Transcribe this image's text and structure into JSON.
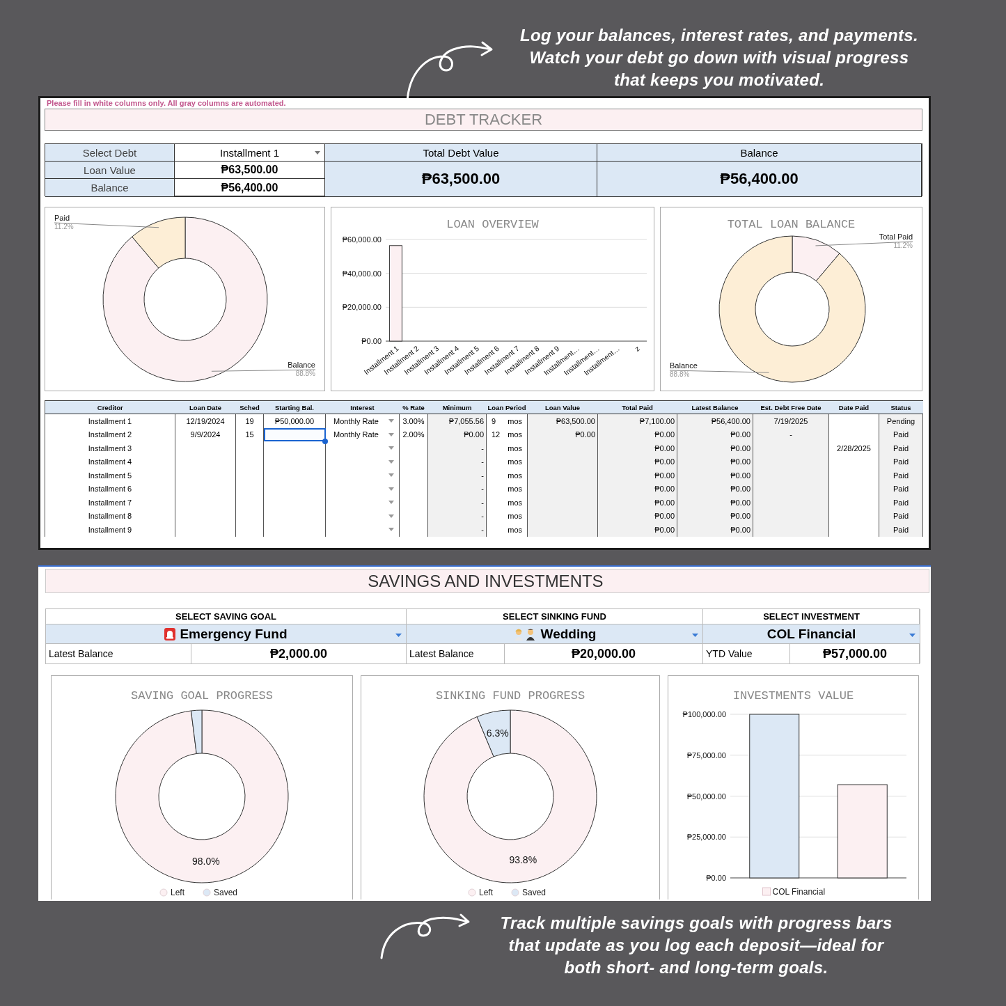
{
  "top_note": {
    "text": "Log your balances, interest rates, and payments.\nWatch your debt go down with visual progress\nthat keeps you motivated."
  },
  "debt_tracker": {
    "notice": "Please fill in white columns only. All gray columns are automated.",
    "title": "DEBT TRACKER",
    "selector": {
      "label": "Select Debt",
      "value": "Installment 1",
      "rows": [
        {
          "label": "Loan Value",
          "value": "₱63,500.00"
        },
        {
          "label": "Balance",
          "value": "₱56,400.00"
        }
      ]
    },
    "totals": [
      {
        "label": "Total Debt Value",
        "value": "₱63,500.00"
      },
      {
        "label": "Balance",
        "value": "₱56,400.00"
      }
    ],
    "charts": [
      {
        "chart_data": {
          "type": "donut",
          "categories": [
            "Balance",
            "Paid"
          ],
          "values": [
            88.8,
            11.2
          ],
          "colors": [
            "#fcf0f2",
            "#fdeed6"
          ],
          "value_labels": [
            "88.8%",
            "11.2%"
          ]
        }
      },
      {
        "chart_data": {
          "type": "bar",
          "title": "LOAN OVERVIEW",
          "grid": true,
          "categories": [
            "Installment 1",
            "Installment 2",
            "Installment 3",
            "Installment 4",
            "Installment 5",
            "Installment 6",
            "Installment 7",
            "Installment 8",
            "Installment 9",
            "Installment…",
            "Installment…",
            "Installment…",
            "z"
          ],
          "values": [
            56400,
            0,
            0,
            0,
            0,
            0,
            0,
            0,
            0,
            0,
            0,
            0,
            0
          ],
          "colors": [
            "#fcf0f2",
            "#fcf0f2",
            "#fcf0f2",
            "#fcf0f2",
            "#fcf0f2",
            "#fcf0f2",
            "#fcf0f2",
            "#fcf0f2",
            "#fcf0f2",
            "#fcf0f2",
            "#fcf0f2",
            "#fcf0f2",
            "#fcf0f2"
          ],
          "ylim": [
            0,
            60000
          ],
          "yticks": [
            {
              "value": 0,
              "label": "₱0.00"
            },
            {
              "value": 20000,
              "label": "₱20,000.00"
            },
            {
              "value": 40000,
              "label": "₱40,000.00"
            },
            {
              "value": 60000,
              "label": "₱60,000.00"
            }
          ]
        }
      },
      {
        "chart_data": {
          "type": "donut",
          "title": "TOTAL LOAN BALANCE",
          "categories": [
            "Total Paid",
            "Balance"
          ],
          "values": [
            11.2,
            88.8
          ],
          "colors": [
            "#fcf0f2",
            "#fdeed6"
          ],
          "value_labels": [
            "11.2%",
            "88.8%"
          ]
        }
      }
    ],
    "table": {
      "columns": [
        {
          "label": "Creditor",
          "kind": "text",
          "automated": false
        },
        {
          "label": "Loan Date",
          "kind": "text",
          "automated": false
        },
        {
          "label": "Sched",
          "kind": "text",
          "automated": false
        },
        {
          "label": "Starting Bal.",
          "kind": "text",
          "automated": false
        },
        {
          "label": "Interest",
          "kind": "dropdown",
          "automated": false
        },
        {
          "label": "% Rate",
          "kind": "text",
          "automated": false
        },
        {
          "label": "Minimum",
          "kind": "text",
          "automated": true
        },
        {
          "label": "Loan Period",
          "kind": "period",
          "automated": false
        },
        {
          "label": "Loan Value",
          "kind": "text",
          "automated": true
        },
        {
          "label": "Total Paid",
          "kind": "text",
          "automated": true
        },
        {
          "label": "Latest Balance",
          "kind": "text",
          "automated": true
        },
        {
          "label": "Est. Debt Free Date",
          "kind": "text",
          "automated": true
        },
        {
          "label": "Date Paid",
          "kind": "text",
          "automated": false
        },
        {
          "label": "Status",
          "kind": "text",
          "automated": true
        }
      ],
      "rows": [
        {
          "starting_selected": false,
          "cells": [
            "Installment 1",
            "12/19/2024",
            "19",
            "₱50,000.00",
            "Monthly Rate",
            "3.00%",
            "₱7,055.56",
            {
              "count": "9",
              "unit": "mos"
            },
            "₱63,500.00",
            "₱7,100.00",
            "₱56,400.00",
            "7/19/2025",
            null,
            "Pending"
          ]
        },
        {
          "starting_selected": true,
          "cells": [
            "Installment 2",
            "9/9/2024",
            "15",
            null,
            "Monthly Rate",
            "2.00%",
            "₱0.00",
            {
              "count": "12",
              "unit": "mos"
            },
            "₱0.00",
            "₱0.00",
            "₱0.00",
            "-",
            null,
            "Paid"
          ]
        },
        {
          "starting_selected": false,
          "cells": [
            "Installment 3",
            null,
            null,
            null,
            null,
            null,
            "-",
            {
              "unit": "mos"
            },
            null,
            "₱0.00",
            "₱0.00",
            null,
            "2/28/2025",
            "Paid"
          ]
        },
        {
          "starting_selected": false,
          "cells": [
            "Installment 4",
            null,
            null,
            null,
            null,
            null,
            "-",
            {
              "unit": "mos"
            },
            null,
            "₱0.00",
            "₱0.00",
            null,
            null,
            "Paid"
          ]
        },
        {
          "starting_selected": false,
          "cells": [
            "Installment 5",
            null,
            null,
            null,
            null,
            null,
            "-",
            {
              "unit": "mos"
            },
            null,
            "₱0.00",
            "₱0.00",
            null,
            null,
            "Paid"
          ]
        },
        {
          "starting_selected": false,
          "cells": [
            "Installment 6",
            null,
            null,
            null,
            null,
            null,
            "-",
            {
              "unit": "mos"
            },
            null,
            "₱0.00",
            "₱0.00",
            null,
            null,
            "Paid"
          ]
        },
        {
          "starting_selected": false,
          "cells": [
            "Installment 7",
            null,
            null,
            null,
            null,
            null,
            "-",
            {
              "unit": "mos"
            },
            null,
            "₱0.00",
            "₱0.00",
            null,
            null,
            "Paid"
          ]
        },
        {
          "starting_selected": false,
          "cells": [
            "Installment 8",
            null,
            null,
            null,
            null,
            null,
            "-",
            {
              "unit": "mos"
            },
            null,
            "₱0.00",
            "₱0.00",
            null,
            null,
            "Paid"
          ]
        },
        {
          "starting_selected": false,
          "cells": [
            "Installment 9",
            null,
            null,
            null,
            null,
            null,
            "-",
            {
              "unit": "mos"
            },
            null,
            "₱0.00",
            "₱0.00",
            null,
            null,
            "Paid"
          ]
        }
      ]
    }
  },
  "savings": {
    "title": "SAVINGS AND INVESTMENTS",
    "selectors": [
      {
        "kind": "goal",
        "header": "SELECT SAVING GOAL",
        "choice": "Emergency Fund",
        "value_label": "Latest Balance",
        "value": "₱2,000.00"
      },
      {
        "kind": "sinking",
        "header": "SELECT SINKING FUND",
        "choice": "Wedding",
        "value_label": "Latest Balance",
        "value": "₱20,000.00"
      },
      {
        "kind": "investment",
        "header": "SELECT INVESTMENT",
        "choice": "COL Financial",
        "value_label": "YTD Value",
        "value": "₱57,000.00"
      }
    ],
    "charts": [
      {
        "legend": true,
        "chart_data": {
          "type": "donut",
          "title": "SAVING GOAL PROGRESS",
          "categories": [
            "Left",
            "Saved"
          ],
          "values": [
            98.0,
            2.0
          ],
          "colors": [
            "#fcf0f2",
            "#dce8f5"
          ],
          "value_labels": [
            "98.0%",
            null
          ]
        }
      },
      {
        "legend": true,
        "chart_data": {
          "type": "donut",
          "title": "SINKING FUND PROGRESS",
          "categories": [
            "Left",
            "Saved"
          ],
          "values": [
            93.8,
            6.3
          ],
          "colors": [
            "#fcf0f2",
            "#dce8f5"
          ],
          "value_labels": [
            "93.8%",
            "6.3%"
          ]
        }
      },
      {
        "legend": true,
        "chart_data": {
          "type": "bar",
          "title": "INVESTMENTS VALUE",
          "grid": true,
          "series": [
            {
              "color": "#dce8f5",
              "values": [
                100000,
                null
              ]
            },
            {
              "name": "COL Financial",
              "color": "#fcf0f2",
              "values": [
                null,
                57000
              ]
            }
          ],
          "ylim": [
            0,
            100000
          ],
          "yticks": [
            {
              "value": 0,
              "label": "₱0.00"
            },
            {
              "value": 25000,
              "label": "₱25,000.00"
            },
            {
              "value": 50000,
              "label": "₱50,000.00"
            },
            {
              "value": 75000,
              "label": "₱75,000.00"
            },
            {
              "value": 100000,
              "label": "₱100,000.00"
            }
          ]
        }
      }
    ]
  },
  "bottom_note": {
    "text": "Track multiple savings goals with progress bars\nthat update as you log each deposit—ideal for\nboth short- and long-term goals."
  }
}
